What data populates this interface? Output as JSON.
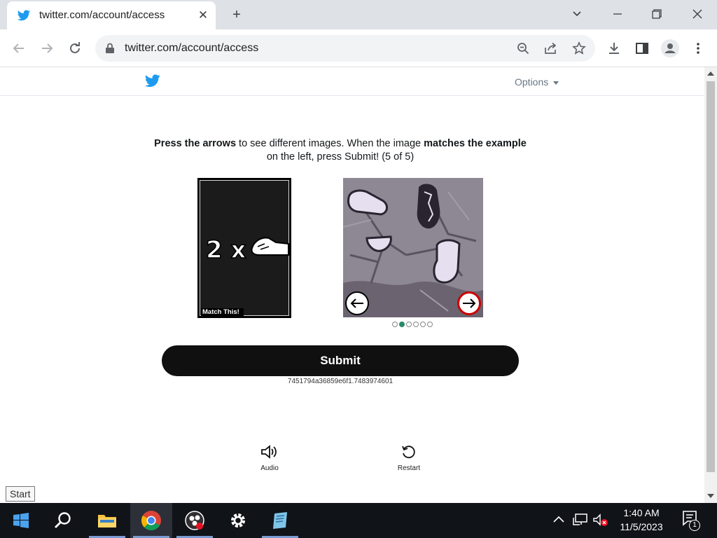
{
  "browser": {
    "tab_title": "twitter.com/account/access",
    "url": "twitter.com/account/access",
    "new_tab_symbol": "+"
  },
  "page": {
    "options_label": "Options",
    "instruction": {
      "p1_bold": "Press the arrows",
      "p2": " to see different images. When the image ",
      "p3_bold": "matches the example",
      "p4": " on the left, press Submit! (5 of 5)"
    },
    "example_text": "2 x",
    "match_label": "Match This!",
    "pagination": {
      "total": 6,
      "active_index": 1
    },
    "submit_label": "Submit",
    "session_id": "7451794a36859e6f1.7483974601",
    "audio_label": "Audio",
    "restart_label": "Restart"
  },
  "taskbar": {
    "tooltip": "Start",
    "time": "1:40 AM",
    "date": "11/5/2023",
    "notification_count": "1"
  },
  "colors": {
    "twitter_blue": "#1d9bf0",
    "submit_bg": "#101010",
    "active_dot": "#2a8a6b"
  }
}
